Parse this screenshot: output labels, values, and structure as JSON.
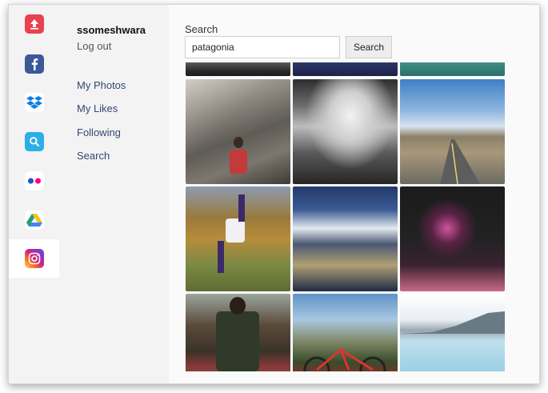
{
  "rail": {
    "items": [
      {
        "name": "upload",
        "icon": "upload-icon",
        "color": "#e8424f"
      },
      {
        "name": "facebook",
        "icon": "facebook-icon",
        "color": "#3b5998"
      },
      {
        "name": "dropbox",
        "icon": "dropbox-icon",
        "color": "#0d7ee5"
      },
      {
        "name": "search",
        "icon": "search-icon",
        "color": "#2eaee6"
      },
      {
        "name": "flickr",
        "icon": "flickr-icon",
        "color": "#ffffff"
      },
      {
        "name": "google-drive",
        "icon": "google-drive-icon",
        "color": "#ffffff"
      },
      {
        "name": "instagram",
        "icon": "instagram-icon",
        "color": "#d62976",
        "active": true
      }
    ]
  },
  "account": {
    "username": "ssomeshwara",
    "logout_label": "Log out"
  },
  "nav": {
    "items": [
      {
        "label": "My Photos"
      },
      {
        "label": "My Likes"
      },
      {
        "label": "Following"
      },
      {
        "label": "Search"
      }
    ]
  },
  "search": {
    "label": "Search",
    "value": "patagonia",
    "button_label": "Search"
  },
  "colors": {
    "link": "#2f4a73",
    "rail_bg": "#f3f3f3",
    "accent_upload": "#e8424f"
  }
}
